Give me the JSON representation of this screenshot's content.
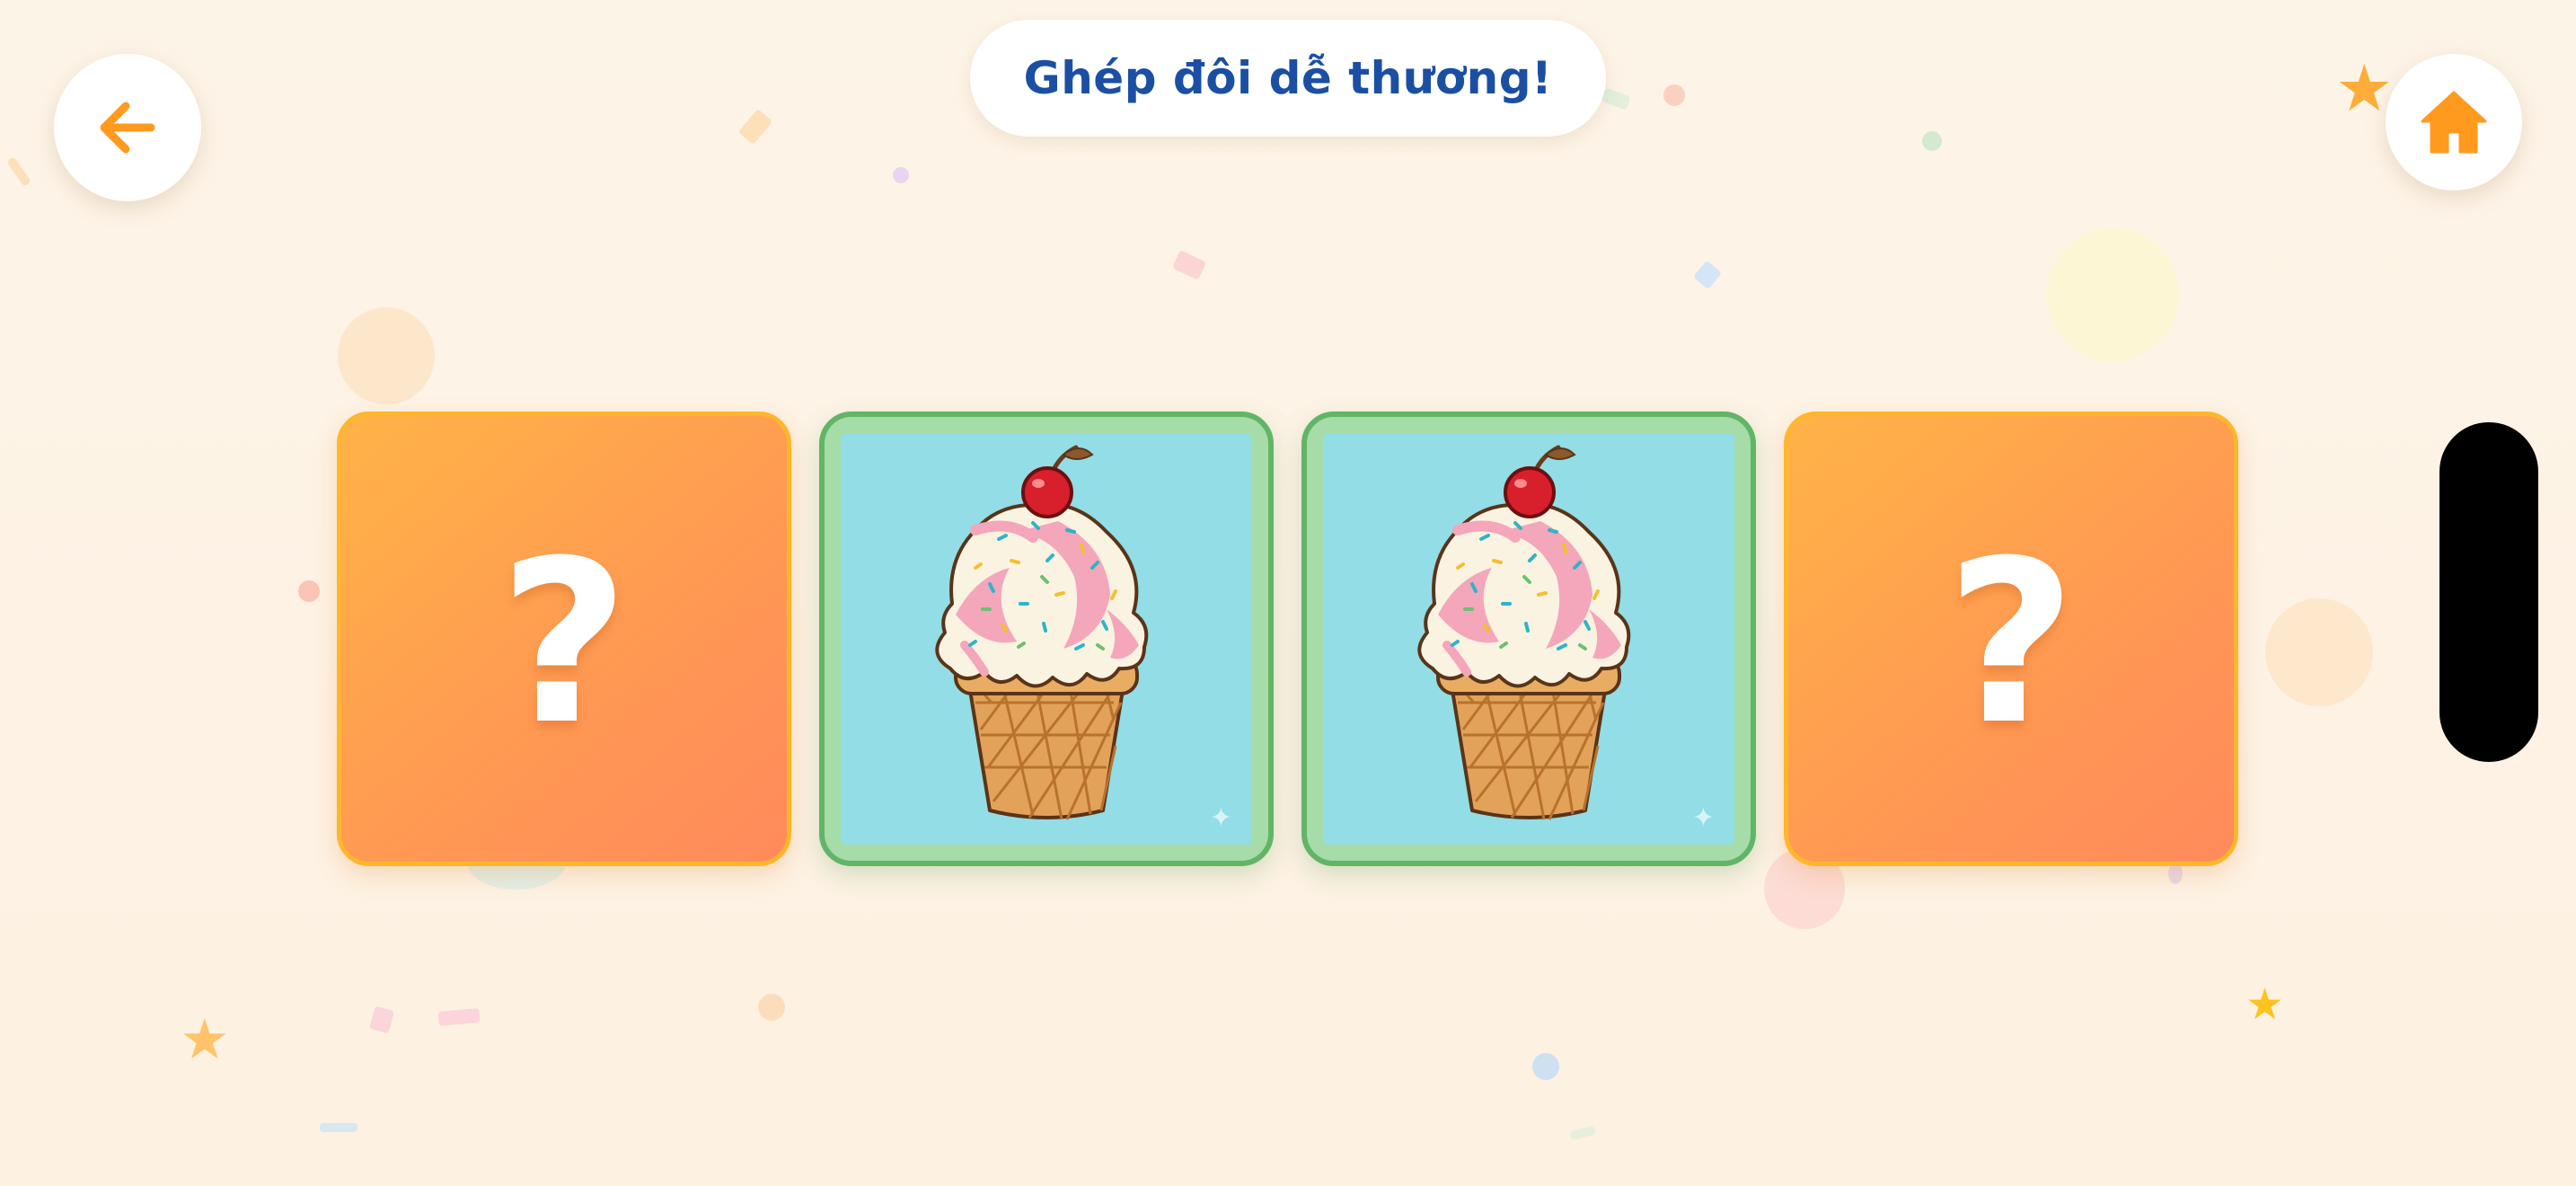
{
  "game": {
    "title": "Ghép đôi dễ thương!",
    "cards": [
      {
        "state": "face-down",
        "symbol": "?"
      },
      {
        "state": "matched",
        "image": "ice-cream-cone"
      },
      {
        "state": "matched",
        "image": "ice-cream-cone"
      },
      {
        "state": "face-down",
        "symbol": "?"
      }
    ]
  },
  "icons": {
    "back": "arrow-left-icon",
    "home": "home-icon",
    "sparkle": "✦"
  },
  "colors": {
    "background": "#fdf2e4",
    "accent_orange": "#ff9a1f",
    "title_blue": "#1b4fa3",
    "card_back": "#ffa54f",
    "card_back_border": "#ffb62b",
    "matched_border": "#62b566",
    "matched_face": "#92dde6"
  }
}
